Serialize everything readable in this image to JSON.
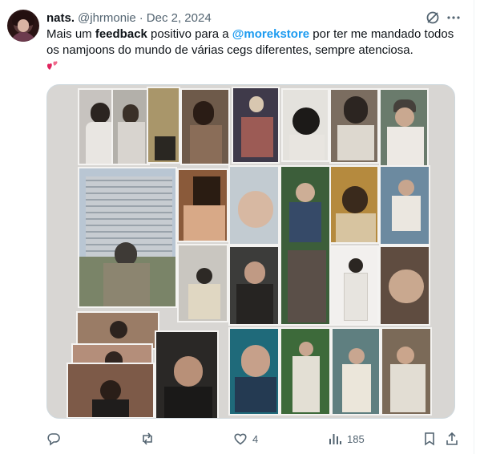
{
  "author": {
    "name": "nats.",
    "handle": "@jhrmonie",
    "separator": "·",
    "date": "Dec 2, 2024"
  },
  "post": {
    "text_1": "Mais um ",
    "text_bold": "feedback",
    "text_2": " positivo para a ",
    "mention": "@morekstore",
    "text_3": " por ter me mandado todos os namjoons do mundo de várias cegs diferentes, sempre atenciosa. "
  },
  "media": {
    "description_alt": ""
  },
  "actions": {
    "reply_count": "",
    "repost_count": "",
    "like_count": "4",
    "views_count": "185"
  },
  "icons": [
    "grok-icon",
    "more-icon",
    "reply-icon",
    "repost-icon",
    "like-icon",
    "views-icon",
    "bookmark-icon",
    "share-icon",
    "two-hearts-emoji"
  ],
  "colors": {
    "link": "#1d9bf0",
    "secondary_text": "#536471",
    "border": "#cfd9de"
  }
}
